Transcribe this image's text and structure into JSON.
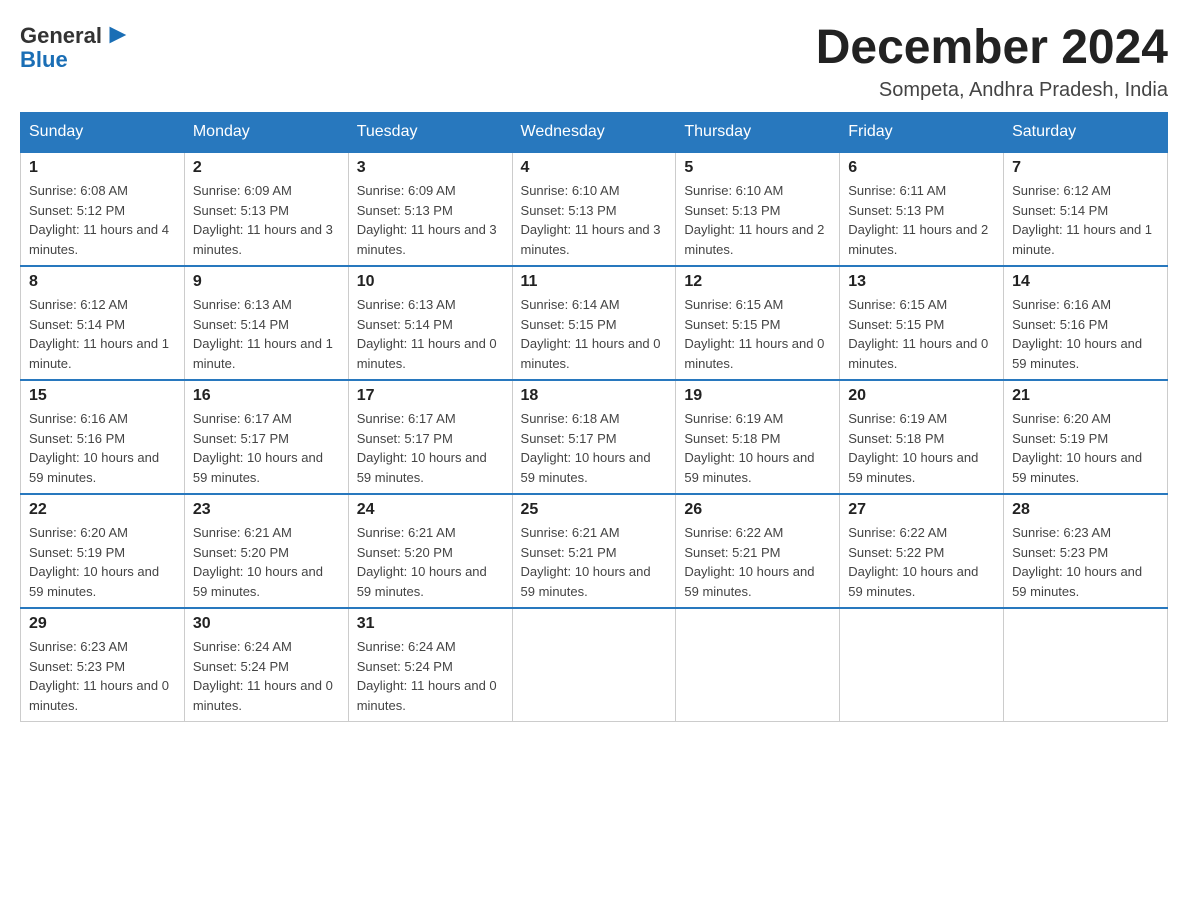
{
  "header": {
    "logo": {
      "general": "General",
      "blue": "Blue",
      "icon": "▶"
    },
    "title": "December 2024",
    "location": "Sompeta, Andhra Pradesh, India"
  },
  "calendar": {
    "days_of_week": [
      "Sunday",
      "Monday",
      "Tuesday",
      "Wednesday",
      "Thursday",
      "Friday",
      "Saturday"
    ],
    "weeks": [
      [
        {
          "date": "1",
          "sunrise": "6:08 AM",
          "sunset": "5:12 PM",
          "daylight": "11 hours and 4 minutes."
        },
        {
          "date": "2",
          "sunrise": "6:09 AM",
          "sunset": "5:13 PM",
          "daylight": "11 hours and 3 minutes."
        },
        {
          "date": "3",
          "sunrise": "6:09 AM",
          "sunset": "5:13 PM",
          "daylight": "11 hours and 3 minutes."
        },
        {
          "date": "4",
          "sunrise": "6:10 AM",
          "sunset": "5:13 PM",
          "daylight": "11 hours and 3 minutes."
        },
        {
          "date": "5",
          "sunrise": "6:10 AM",
          "sunset": "5:13 PM",
          "daylight": "11 hours and 2 minutes."
        },
        {
          "date": "6",
          "sunrise": "6:11 AM",
          "sunset": "5:13 PM",
          "daylight": "11 hours and 2 minutes."
        },
        {
          "date": "7",
          "sunrise": "6:12 AM",
          "sunset": "5:14 PM",
          "daylight": "11 hours and 1 minute."
        }
      ],
      [
        {
          "date": "8",
          "sunrise": "6:12 AM",
          "sunset": "5:14 PM",
          "daylight": "11 hours and 1 minute."
        },
        {
          "date": "9",
          "sunrise": "6:13 AM",
          "sunset": "5:14 PM",
          "daylight": "11 hours and 1 minute."
        },
        {
          "date": "10",
          "sunrise": "6:13 AM",
          "sunset": "5:14 PM",
          "daylight": "11 hours and 0 minutes."
        },
        {
          "date": "11",
          "sunrise": "6:14 AM",
          "sunset": "5:15 PM",
          "daylight": "11 hours and 0 minutes."
        },
        {
          "date": "12",
          "sunrise": "6:15 AM",
          "sunset": "5:15 PM",
          "daylight": "11 hours and 0 minutes."
        },
        {
          "date": "13",
          "sunrise": "6:15 AM",
          "sunset": "5:15 PM",
          "daylight": "11 hours and 0 minutes."
        },
        {
          "date": "14",
          "sunrise": "6:16 AM",
          "sunset": "5:16 PM",
          "daylight": "10 hours and 59 minutes."
        }
      ],
      [
        {
          "date": "15",
          "sunrise": "6:16 AM",
          "sunset": "5:16 PM",
          "daylight": "10 hours and 59 minutes."
        },
        {
          "date": "16",
          "sunrise": "6:17 AM",
          "sunset": "5:17 PM",
          "daylight": "10 hours and 59 minutes."
        },
        {
          "date": "17",
          "sunrise": "6:17 AM",
          "sunset": "5:17 PM",
          "daylight": "10 hours and 59 minutes."
        },
        {
          "date": "18",
          "sunrise": "6:18 AM",
          "sunset": "5:17 PM",
          "daylight": "10 hours and 59 minutes."
        },
        {
          "date": "19",
          "sunrise": "6:19 AM",
          "sunset": "5:18 PM",
          "daylight": "10 hours and 59 minutes."
        },
        {
          "date": "20",
          "sunrise": "6:19 AM",
          "sunset": "5:18 PM",
          "daylight": "10 hours and 59 minutes."
        },
        {
          "date": "21",
          "sunrise": "6:20 AM",
          "sunset": "5:19 PM",
          "daylight": "10 hours and 59 minutes."
        }
      ],
      [
        {
          "date": "22",
          "sunrise": "6:20 AM",
          "sunset": "5:19 PM",
          "daylight": "10 hours and 59 minutes."
        },
        {
          "date": "23",
          "sunrise": "6:21 AM",
          "sunset": "5:20 PM",
          "daylight": "10 hours and 59 minutes."
        },
        {
          "date": "24",
          "sunrise": "6:21 AM",
          "sunset": "5:20 PM",
          "daylight": "10 hours and 59 minutes."
        },
        {
          "date": "25",
          "sunrise": "6:21 AM",
          "sunset": "5:21 PM",
          "daylight": "10 hours and 59 minutes."
        },
        {
          "date": "26",
          "sunrise": "6:22 AM",
          "sunset": "5:21 PM",
          "daylight": "10 hours and 59 minutes."
        },
        {
          "date": "27",
          "sunrise": "6:22 AM",
          "sunset": "5:22 PM",
          "daylight": "10 hours and 59 minutes."
        },
        {
          "date": "28",
          "sunrise": "6:23 AM",
          "sunset": "5:23 PM",
          "daylight": "10 hours and 59 minutes."
        }
      ],
      [
        {
          "date": "29",
          "sunrise": "6:23 AM",
          "sunset": "5:23 PM",
          "daylight": "11 hours and 0 minutes."
        },
        {
          "date": "30",
          "sunrise": "6:24 AM",
          "sunset": "5:24 PM",
          "daylight": "11 hours and 0 minutes."
        },
        {
          "date": "31",
          "sunrise": "6:24 AM",
          "sunset": "5:24 PM",
          "daylight": "11 hours and 0 minutes."
        },
        null,
        null,
        null,
        null
      ]
    ]
  }
}
